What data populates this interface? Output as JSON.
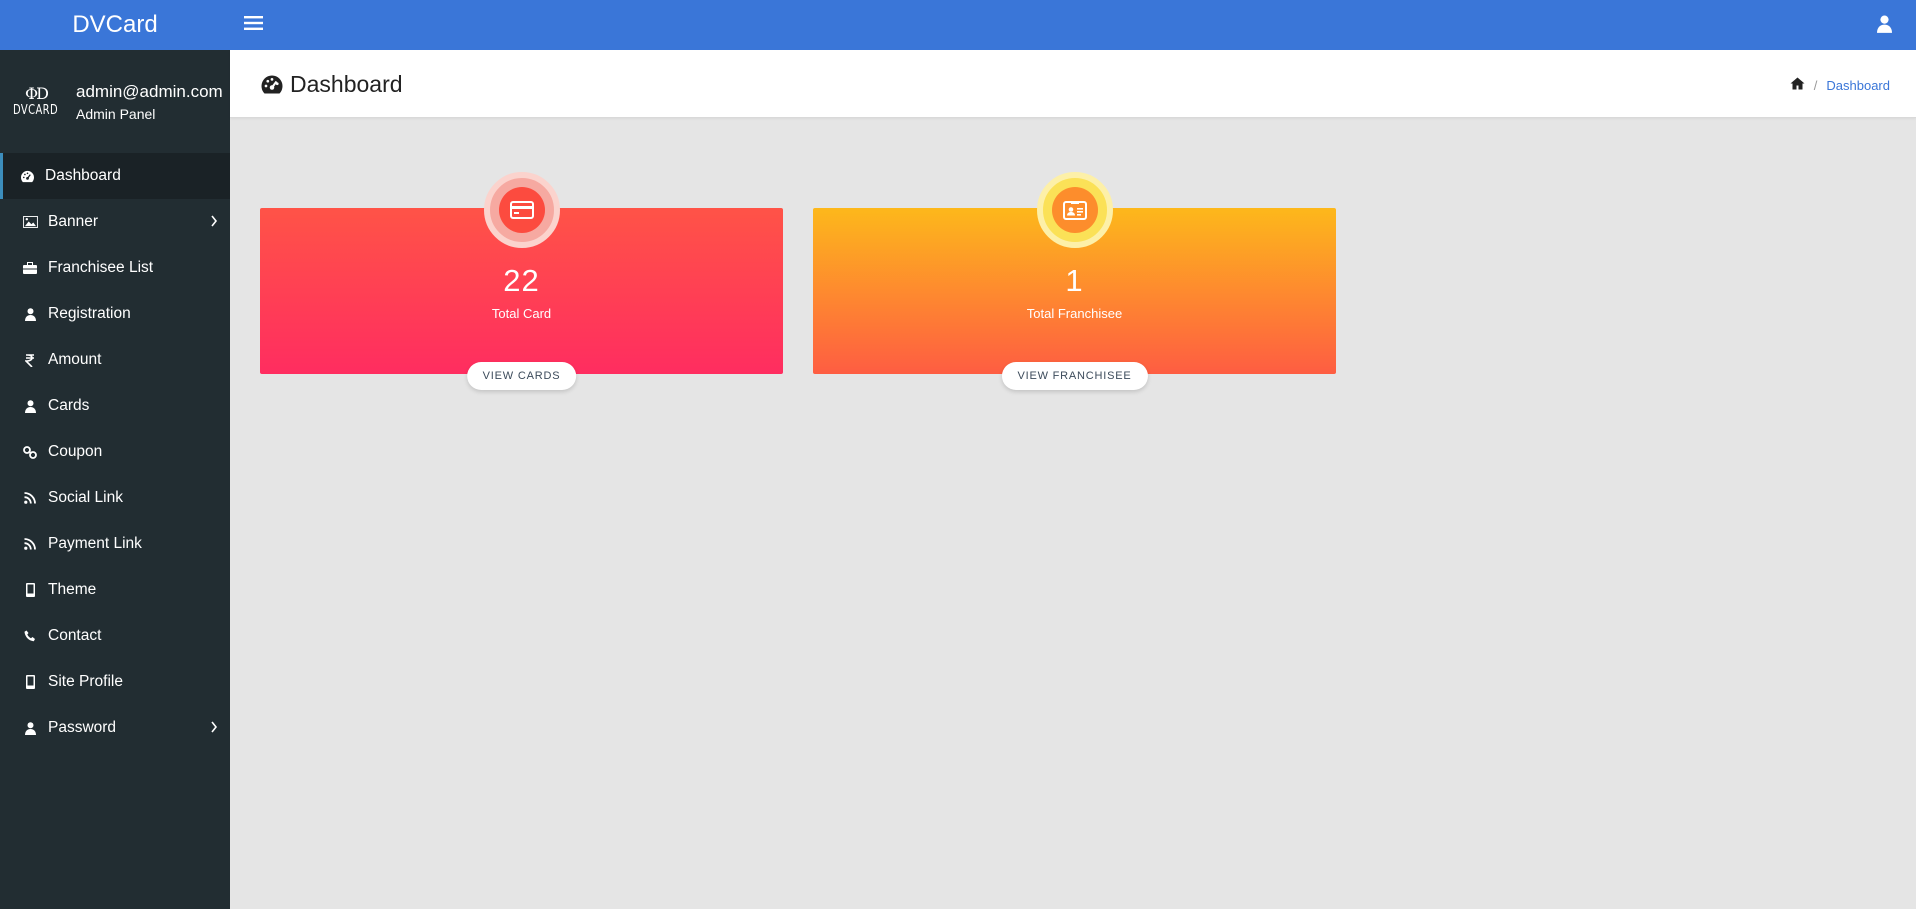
{
  "app": {
    "brand": "DVCard"
  },
  "logo": {
    "mark": "ΦD",
    "word": "DVCARD"
  },
  "user": {
    "email": "admin@admin.com",
    "role": "Admin Panel"
  },
  "sidebar": {
    "items": [
      {
        "label": "Dashboard",
        "icon": "dashboard-icon",
        "active": true
      },
      {
        "label": "Banner",
        "icon": "image-icon",
        "has_submenu": true
      },
      {
        "label": "Franchisee List",
        "icon": "briefcase-icon"
      },
      {
        "label": "Registration",
        "icon": "user-icon"
      },
      {
        "label": "Amount",
        "icon": "rupee-icon"
      },
      {
        "label": "Cards",
        "icon": "user-icon"
      },
      {
        "label": "Coupon",
        "icon": "link-icon"
      },
      {
        "label": "Social Link",
        "icon": "rss-icon"
      },
      {
        "label": "Payment Link",
        "icon": "rss-icon"
      },
      {
        "label": "Theme",
        "icon": "mobile-icon"
      },
      {
        "label": "Contact",
        "icon": "phone-icon"
      },
      {
        "label": "Site Profile",
        "icon": "mobile-icon"
      },
      {
        "label": "Password",
        "icon": "user-icon",
        "has_submenu": true
      }
    ]
  },
  "header": {
    "title": "Dashboard",
    "breadcrumb": [
      "Dashboard"
    ]
  },
  "cards": [
    {
      "count": "22",
      "label": "Total Card",
      "button": "VIEW CARDS",
      "icon": "credit-card-icon"
    },
    {
      "count": "1",
      "label": "Total Franchisee",
      "button": "VIEW FRANCHISEE",
      "icon": "id-card-icon"
    }
  ],
  "colors": {
    "topbar": "#3a76d8",
    "sidebar": "#222d32",
    "card_red": "#ff3d55",
    "card_orange": "#fd9a2c"
  }
}
